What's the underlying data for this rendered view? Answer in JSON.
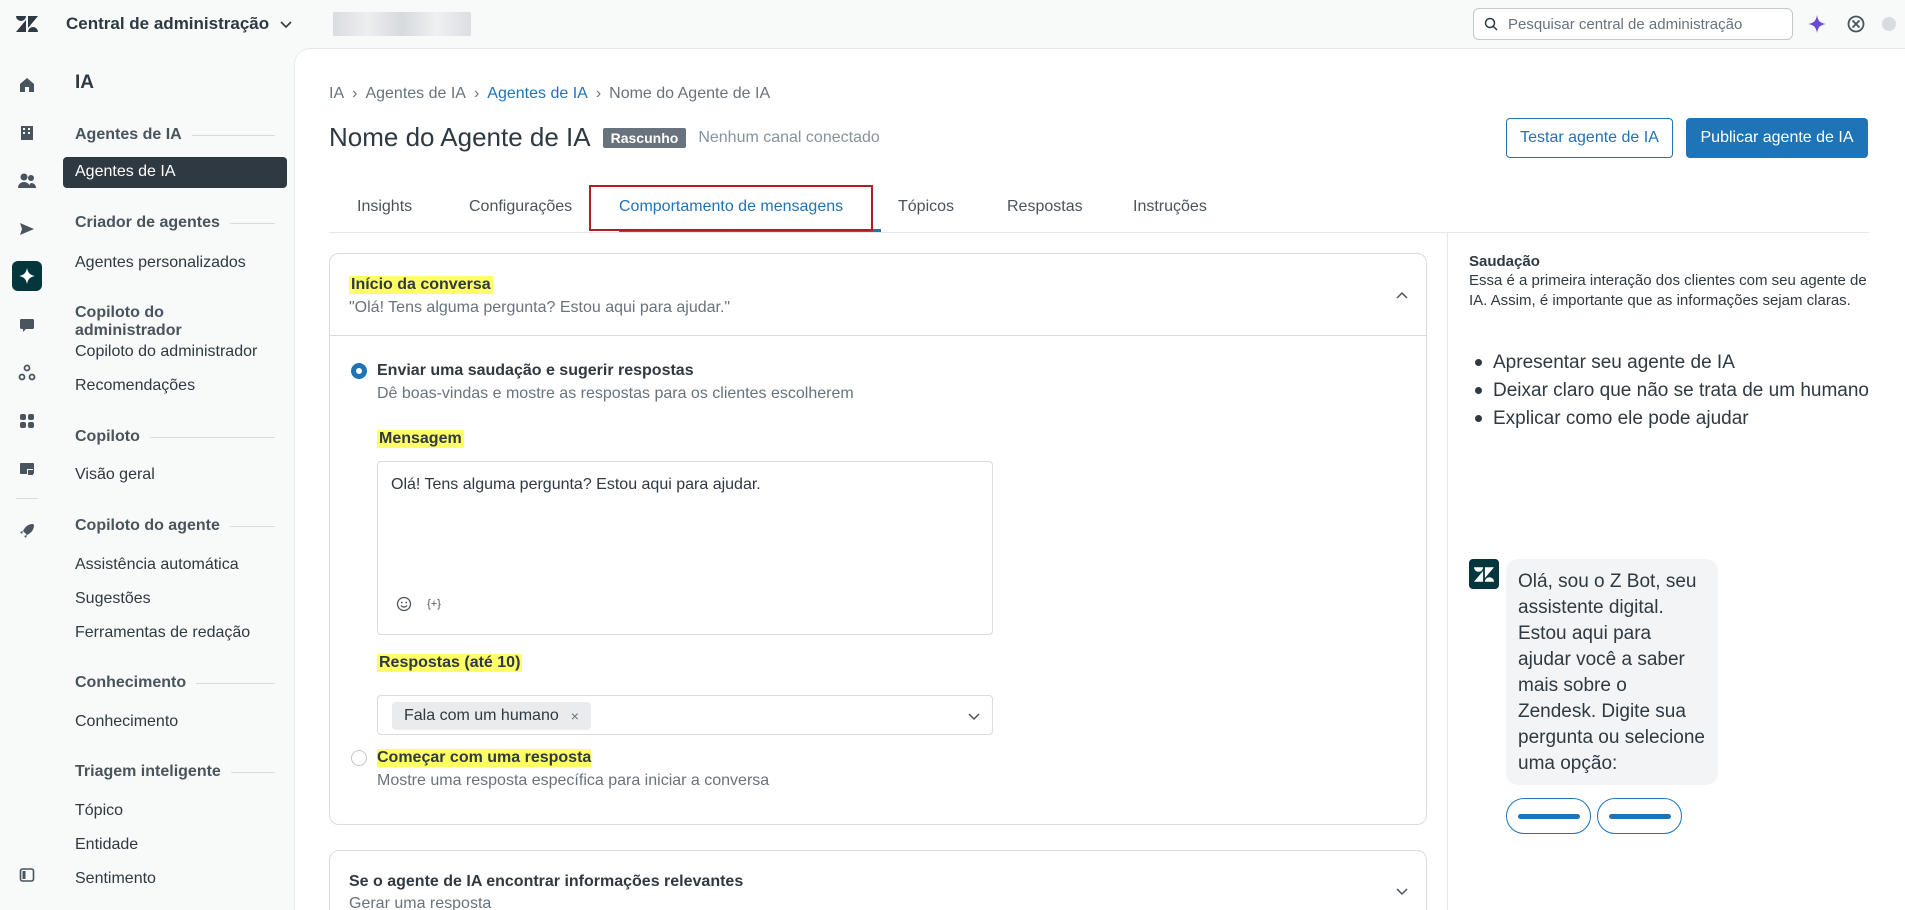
{
  "topbar": {
    "app_title": "Central de administração",
    "search_placeholder": "Pesquisar central de administração"
  },
  "subnav": {
    "title": "IA",
    "sections": [
      {
        "label": "Agentes de IA",
        "items": [
          "Agentes de IA"
        ]
      },
      {
        "label": "Criador de agentes",
        "items": [
          "Agentes personalizados"
        ]
      },
      {
        "label": "Copiloto do administrador",
        "items": [
          "Copiloto do administrador",
          "Recomendações"
        ]
      },
      {
        "label": "Copiloto",
        "items": [
          "Visão geral"
        ]
      },
      {
        "label": "Copiloto do agente",
        "items": [
          "Assistência automática",
          "Sugestões",
          "Ferramentas de redação"
        ]
      },
      {
        "label": "Conhecimento",
        "items": [
          "Conhecimento"
        ]
      },
      {
        "label": "Triagem inteligente",
        "items": [
          "Tópico",
          "Entidade",
          "Sentimento"
        ]
      }
    ],
    "active_item": "Agentes de IA"
  },
  "breadcrumb": {
    "items": [
      "IA",
      "Agentes de IA",
      "Agentes de IA",
      "Nome do Agente de IA"
    ]
  },
  "page": {
    "title": "Nome do Agente de IA",
    "status_badge": "Rascunho",
    "channel_status": "Nenhum canal conectado",
    "test_button": "Testar agente de IA",
    "publish_button": "Publicar agente de IA"
  },
  "tabs": [
    "Insights",
    "Configurações",
    "Comportamento de mensagens",
    "Tópicos",
    "Respostas",
    "Instruções"
  ],
  "active_tab": "Comportamento de mensagens",
  "conversation_start": {
    "title": "Início da conversa",
    "summary": "\"Olá! Tens alguma pergunta? Estou aqui para ajudar.\"",
    "option1_label": "Enviar uma saudação e sugerir respostas",
    "option1_hint": "Dê boas-vindas e mostre as respostas para os clientes escolherem",
    "message_label": "Mensagem",
    "message_value": "Olá! Tens alguma pergunta? Estou aqui para ajudar.",
    "placeholder_icon_text": "{+}",
    "replies_label": "Respostas (até 10)",
    "reply_tag": "Fala com um humano",
    "reply_tag_remove": "×",
    "option2_label": "Começar com uma resposta",
    "option2_hint": "Mostre uma resposta específica para iniciar a conversa"
  },
  "relevant_info": {
    "title": "Se o agente de IA encontrar informações relevantes",
    "summary": "Gerar uma resposta"
  },
  "aside": {
    "title": "Saudação",
    "description": "Essa é a primeira interação dos clientes com seu agente de IA. Assim, é importante que as informações sejam claras.",
    "tips": [
      "Apresentar seu agente de IA",
      "Deixar claro que não se trata de um humano",
      "Explicar como ele pode ajudar"
    ],
    "bot_message": "Olá, sou o Z Bot, seu assistente digital. Estou aqui para ajudar você a saber mais sobre o Zendesk. Digite sua pergunta ou selecione uma opção:"
  },
  "colors": {
    "accent": "#1f73b7",
    "brand_dark": "#03363d",
    "highlight": "#ffff66",
    "tab_outline": "#b01d25"
  }
}
